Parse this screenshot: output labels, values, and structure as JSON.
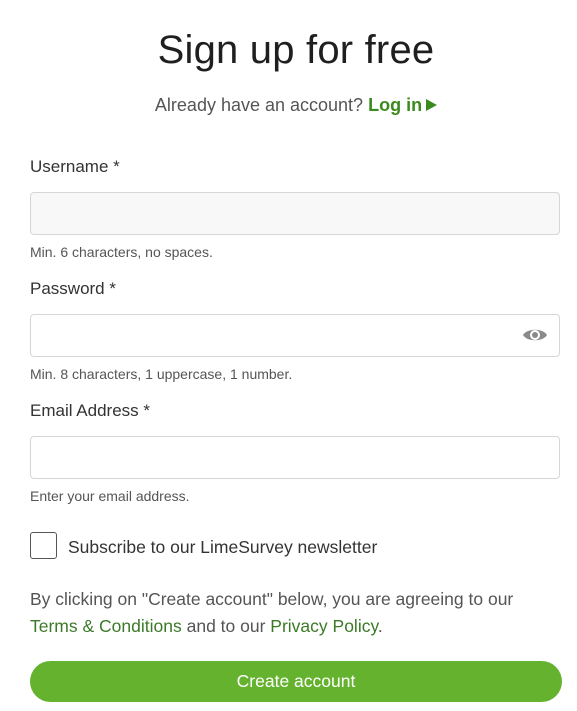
{
  "header": {
    "title": "Sign up for free",
    "login_prompt": "Already have an account?",
    "login_link": "Log in"
  },
  "form": {
    "username": {
      "label": "Username *",
      "value": "",
      "hint": "Min. 6 characters, no spaces."
    },
    "password": {
      "label": "Password *",
      "value": "",
      "hint": "Min. 8 characters, 1 uppercase, 1 number.",
      "toggle_icon": "eye-icon"
    },
    "email": {
      "label": "Email Address *",
      "value": "",
      "hint": "Enter your email address."
    },
    "newsletter": {
      "label": "Subscribe to our LimeSurvey newsletter",
      "checked": false
    },
    "agreement": {
      "prefix": "By clicking on \"Create account\" below, you are agreeing to our",
      "terms_link": "Terms & Conditions",
      "middle": "and to our",
      "privacy_link": "Privacy Policy",
      "suffix": "."
    },
    "submit_label": "Create account"
  },
  "colors": {
    "accent": "#65b22f",
    "link": "#3b8a1d"
  }
}
